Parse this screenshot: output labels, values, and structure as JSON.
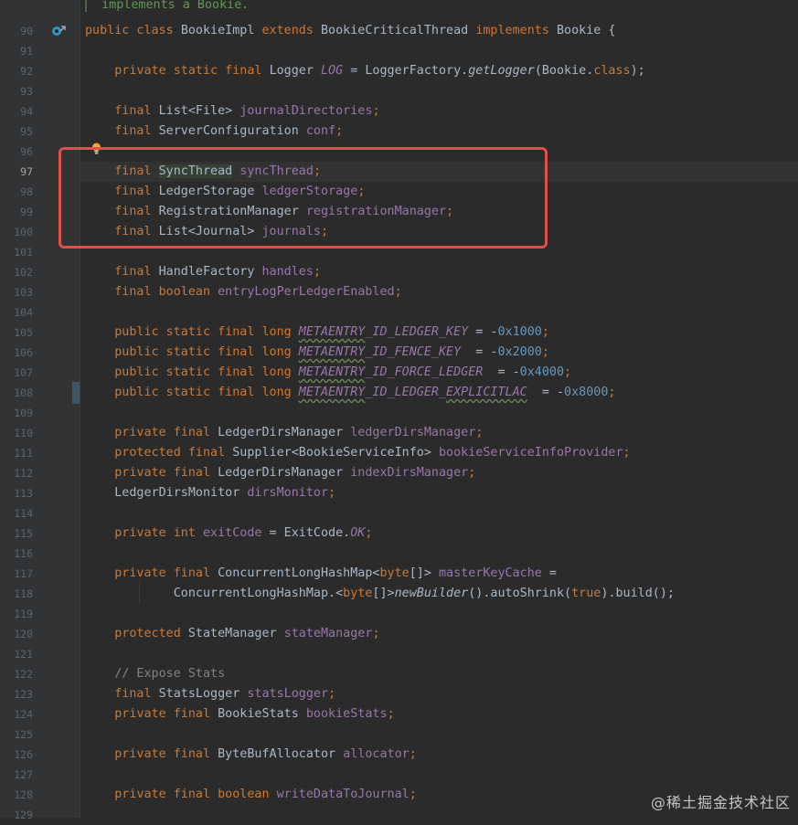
{
  "editor": {
    "doc_comment_top": "implements a Bookie.",
    "caret_line": "97",
    "lines": [
      {
        "n": "90",
        "segs": [
          [
            "kw",
            "public class "
          ],
          [
            "id",
            "BookieImpl "
          ],
          [
            "kw",
            "extends "
          ],
          [
            "id",
            "BookieCriticalThread "
          ],
          [
            "kw",
            "implements "
          ],
          [
            "id",
            "Bookie {"
          ]
        ]
      },
      {
        "n": "91",
        "segs": []
      },
      {
        "n": "92",
        "segs": [
          [
            "id",
            "    "
          ],
          [
            "kw",
            "private static final "
          ],
          [
            "id",
            "Logger "
          ],
          [
            "const",
            "LOG"
          ],
          [
            "id",
            " = LoggerFactory."
          ],
          [
            "static",
            "getLogger"
          ],
          [
            "id",
            "(Bookie."
          ],
          [
            "kw",
            "class"
          ],
          [
            "id",
            ");"
          ]
        ]
      },
      {
        "n": "93",
        "segs": []
      },
      {
        "n": "94",
        "segs": [
          [
            "id",
            "    "
          ],
          [
            "kw",
            "final "
          ],
          [
            "id",
            "List<File> "
          ],
          [
            "field",
            "journalDirectories"
          ],
          [
            "kw",
            ";"
          ]
        ]
      },
      {
        "n": "95",
        "segs": [
          [
            "id",
            "    "
          ],
          [
            "kw",
            "final "
          ],
          [
            "id",
            "ServerConfiguration "
          ],
          [
            "field",
            "conf"
          ],
          [
            "kw",
            ";"
          ]
        ]
      },
      {
        "n": "96",
        "segs": []
      },
      {
        "n": "97",
        "segs": [
          [
            "id",
            "    "
          ],
          [
            "kw",
            "final "
          ],
          [
            "hl",
            "Sync"
          ],
          [
            "caret",
            ""
          ],
          [
            "hl",
            "Thread"
          ],
          [
            "id",
            " "
          ],
          [
            "field",
            "syncThread"
          ],
          [
            "kw",
            ";"
          ]
        ]
      },
      {
        "n": "98",
        "segs": [
          [
            "id",
            "    "
          ],
          [
            "kw",
            "final "
          ],
          [
            "id",
            "LedgerStorage "
          ],
          [
            "field",
            "ledgerStorage"
          ],
          [
            "kw",
            ";"
          ]
        ]
      },
      {
        "n": "99",
        "segs": [
          [
            "id",
            "    "
          ],
          [
            "kw",
            "final "
          ],
          [
            "id",
            "RegistrationManager "
          ],
          [
            "field",
            "registrationManager"
          ],
          [
            "kw",
            ";"
          ]
        ]
      },
      {
        "n": "100",
        "segs": [
          [
            "id",
            "    "
          ],
          [
            "kw",
            "final "
          ],
          [
            "id",
            "List<Journal> "
          ],
          [
            "field",
            "journals"
          ],
          [
            "kw",
            ";"
          ]
        ]
      },
      {
        "n": "101",
        "segs": []
      },
      {
        "n": "102",
        "segs": [
          [
            "id",
            "    "
          ],
          [
            "kw",
            "final "
          ],
          [
            "id",
            "HandleFactory "
          ],
          [
            "field",
            "handles"
          ],
          [
            "kw",
            ";"
          ]
        ]
      },
      {
        "n": "103",
        "segs": [
          [
            "id",
            "    "
          ],
          [
            "kw",
            "final boolean "
          ],
          [
            "field",
            "entryLogPerLedgerEnabled"
          ],
          [
            "kw",
            ";"
          ]
        ]
      },
      {
        "n": "104",
        "segs": []
      },
      {
        "n": "105",
        "segs": [
          [
            "id",
            "    "
          ],
          [
            "kw",
            "public static final long "
          ],
          [
            "constw",
            "METAENTRY"
          ],
          [
            "const",
            "_ID_LEDGER_KEY"
          ],
          [
            "id",
            " = -"
          ],
          [
            "num",
            "0x1000"
          ],
          [
            "kw",
            ";"
          ]
        ]
      },
      {
        "n": "106",
        "segs": [
          [
            "id",
            "    "
          ],
          [
            "kw",
            "public static final long "
          ],
          [
            "constw",
            "METAENTRY"
          ],
          [
            "const",
            "_ID_FENCE_KEY"
          ],
          [
            "id",
            "  = -"
          ],
          [
            "num",
            "0x2000"
          ],
          [
            "kw",
            ";"
          ]
        ]
      },
      {
        "n": "107",
        "segs": [
          [
            "id",
            "    "
          ],
          [
            "kw",
            "public static final long "
          ],
          [
            "constw",
            "METAENTRY"
          ],
          [
            "const",
            "_ID_FORCE_LEDGER"
          ],
          [
            "id",
            "  = -"
          ],
          [
            "num",
            "0x4000"
          ],
          [
            "kw",
            ";"
          ]
        ]
      },
      {
        "n": "108",
        "segs": [
          [
            "id",
            "    "
          ],
          [
            "kw",
            "public static final long "
          ],
          [
            "constw",
            "METAENTRY"
          ],
          [
            "const",
            "_ID_LEDGER_"
          ],
          [
            "constw",
            "EXPLICITLAC"
          ],
          [
            "id",
            "  = -"
          ],
          [
            "num",
            "0x8000"
          ],
          [
            "kw",
            ";"
          ]
        ]
      },
      {
        "n": "109",
        "segs": []
      },
      {
        "n": "110",
        "segs": [
          [
            "id",
            "    "
          ],
          [
            "kw",
            "private final "
          ],
          [
            "id",
            "LedgerDirsManager "
          ],
          [
            "field",
            "ledgerDirsManager"
          ],
          [
            "kw",
            ";"
          ]
        ]
      },
      {
        "n": "111",
        "segs": [
          [
            "id",
            "    "
          ],
          [
            "kw",
            "protected final "
          ],
          [
            "id",
            "Supplier<BookieServiceInfo> "
          ],
          [
            "field",
            "bookieServiceInfoProvider"
          ],
          [
            "kw",
            ";"
          ]
        ]
      },
      {
        "n": "112",
        "segs": [
          [
            "id",
            "    "
          ],
          [
            "kw",
            "private final "
          ],
          [
            "id",
            "LedgerDirsManager "
          ],
          [
            "field",
            "indexDirsManager"
          ],
          [
            "kw",
            ";"
          ]
        ]
      },
      {
        "n": "113",
        "segs": [
          [
            "id",
            "    LedgerDirsMonitor "
          ],
          [
            "field",
            "dirsMonitor"
          ],
          [
            "kw",
            ";"
          ]
        ]
      },
      {
        "n": "114",
        "segs": []
      },
      {
        "n": "115",
        "segs": [
          [
            "id",
            "    "
          ],
          [
            "kw",
            "private int "
          ],
          [
            "field",
            "exitCode"
          ],
          [
            "id",
            " = ExitCode."
          ],
          [
            "const",
            "OK"
          ],
          [
            "kw",
            ";"
          ]
        ]
      },
      {
        "n": "116",
        "segs": []
      },
      {
        "n": "117",
        "segs": [
          [
            "id",
            "    "
          ],
          [
            "kw",
            "private final "
          ],
          [
            "id",
            "ConcurrentLongHashMap<"
          ],
          [
            "kw",
            "byte"
          ],
          [
            "id",
            "[]> "
          ],
          [
            "field",
            "masterKeyCache"
          ],
          [
            "id",
            " ="
          ]
        ]
      },
      {
        "n": "118",
        "segs": [
          [
            "id",
            "            ConcurrentLongHashMap.<"
          ],
          [
            "kw",
            "byte"
          ],
          [
            "id",
            "[]>"
          ],
          [
            "static",
            "newBuilder"
          ],
          [
            "id",
            "().autoShrink("
          ],
          [
            "kw",
            "true"
          ],
          [
            "id",
            ").build();"
          ]
        ]
      },
      {
        "n": "119",
        "segs": []
      },
      {
        "n": "120",
        "segs": [
          [
            "id",
            "    "
          ],
          [
            "kw",
            "protected "
          ],
          [
            "id",
            "StateManager "
          ],
          [
            "field",
            "stateManager"
          ],
          [
            "kw",
            ";"
          ]
        ]
      },
      {
        "n": "121",
        "segs": []
      },
      {
        "n": "122",
        "segs": [
          [
            "comment",
            "    // Expose Stats"
          ]
        ]
      },
      {
        "n": "123",
        "segs": [
          [
            "id",
            "    "
          ],
          [
            "kw",
            "final "
          ],
          [
            "id",
            "StatsLogger "
          ],
          [
            "field",
            "statsLogger"
          ],
          [
            "kw",
            ";"
          ]
        ]
      },
      {
        "n": "124",
        "segs": [
          [
            "id",
            "    "
          ],
          [
            "kw",
            "private final "
          ],
          [
            "id",
            "BookieStats "
          ],
          [
            "field",
            "bookieStats"
          ],
          [
            "kw",
            ";"
          ]
        ]
      },
      {
        "n": "125",
        "segs": []
      },
      {
        "n": "126",
        "segs": [
          [
            "id",
            "    "
          ],
          [
            "kw",
            "private final "
          ],
          [
            "id",
            "ByteBufAllocator "
          ],
          [
            "field",
            "allocator"
          ],
          [
            "kw",
            ";"
          ]
        ]
      },
      {
        "n": "127",
        "segs": []
      },
      {
        "n": "128",
        "segs": [
          [
            "id",
            "    "
          ],
          [
            "kw",
            "private final boolean "
          ],
          [
            "field",
            "writeDataToJournal"
          ],
          [
            "kw",
            ";"
          ]
        ]
      },
      {
        "n": "129",
        "segs": []
      }
    ]
  },
  "watermark": "@稀土掘金技术社区",
  "colors": {
    "background": "#2b2b2b",
    "keyword": "#cc7832",
    "field": "#9876aa",
    "number": "#6897bb",
    "highlight_box": "#e0514b"
  },
  "icons": {
    "gutter_line_90": "implementation-marker-icon",
    "line_96": "lightbulb-icon"
  }
}
